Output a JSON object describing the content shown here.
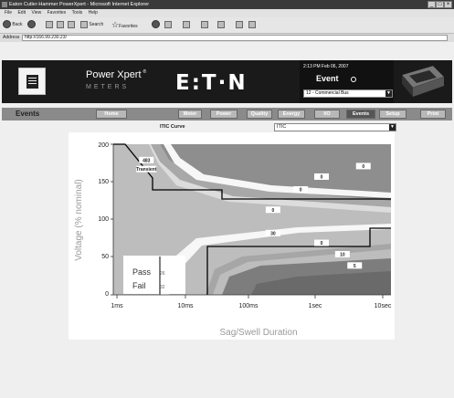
{
  "window": {
    "title": "Eaton Cutler-Hammer PowerXpert - Microsoft Internet Explorer",
    "menu": [
      "File",
      "Edit",
      "View",
      "Favorites",
      "Tools",
      "Help"
    ],
    "toolbar": {
      "back": "Back",
      "search": "Search",
      "favorites": "Favorites"
    },
    "address_label": "Address",
    "address_value": "http://166.99.230.23/"
  },
  "header": {
    "brand_line1": "Power Xpert",
    "brand_reg": "®",
    "brand_line2": "METERS",
    "company": "E:T·N",
    "datetime": "2:13 PM  Feb 06, 2007",
    "event_label": "Event",
    "event_select": "12 - Commercial Bus"
  },
  "nav": {
    "section_title": "Events",
    "buttons": [
      "Home",
      "Meter",
      "Power",
      "Quality",
      "Energy",
      "I/O",
      "Events",
      "Setup",
      "Print"
    ],
    "active": "Events"
  },
  "curve": {
    "label": "ITIC Curve",
    "selected": "ITIC"
  },
  "chart_data": {
    "type": "scatter",
    "title": "",
    "xlabel": "Sag/Swell Duration",
    "ylabel": "Voltage (% nominal)",
    "xscale": "log",
    "x_ticks": [
      "1ms",
      "10ms",
      "100ms",
      "1sec",
      "10sec"
    ],
    "y_ticks": [
      "0",
      "50",
      "100",
      "150",
      "200"
    ],
    "ylim": [
      0,
      200
    ],
    "grid": true,
    "pass_label": "Pass",
    "pass_value": "26",
    "fail_label": "Fail",
    "fail_value": "32",
    "count_labels": [
      {
        "text": "483",
        "x": "3ms",
        "y": 179
      },
      {
        "text": "Transient",
        "x": "3ms",
        "y": 167
      },
      {
        "text": "0",
        "x": "4sec",
        "y": 171
      },
      {
        "text": "0",
        "x": "1sec",
        "y": 157
      },
      {
        "text": "0",
        "x": "500ms",
        "y": 140
      },
      {
        "text": "0",
        "x": "200ms",
        "y": 113
      },
      {
        "text": "30",
        "x": "200ms",
        "y": 82
      },
      {
        "text": "0",
        "x": "1sec",
        "y": 69
      },
      {
        "text": "10",
        "x": "2sec",
        "y": 54
      },
      {
        "text": "5",
        "x": "3sec",
        "y": 39
      }
    ]
  }
}
